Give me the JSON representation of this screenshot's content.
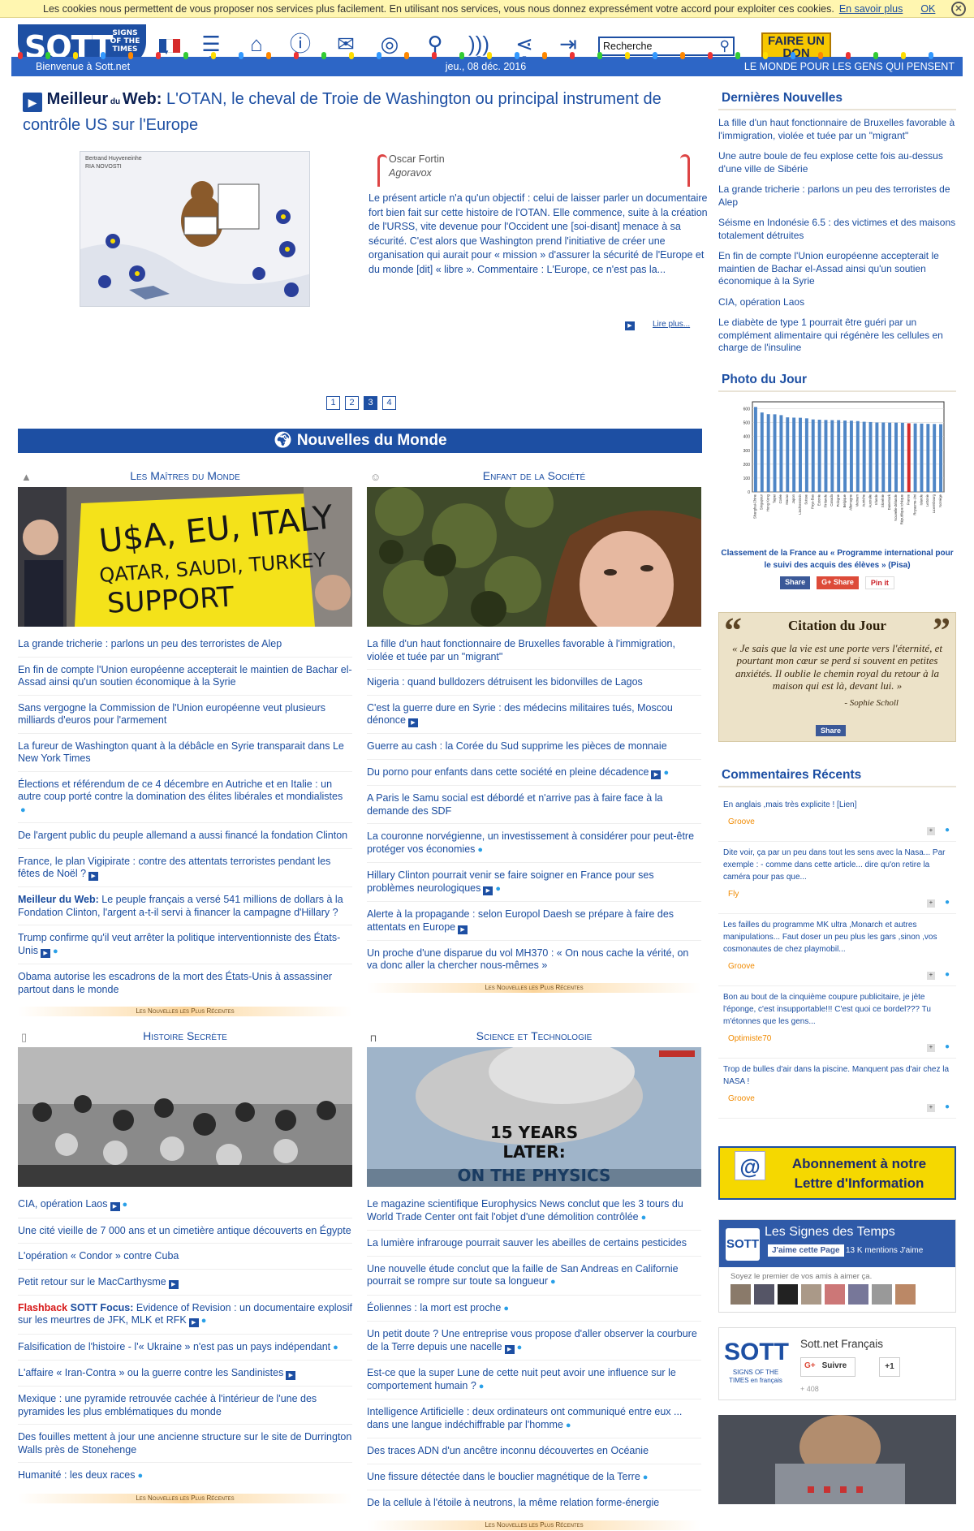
{
  "cookie": {
    "text": "Les cookies nous permettent de vous proposer nos services plus facilement. En utilisant nos services, vous nous donnez expressément votre accord pour exploiter ces cookies.",
    "link": "En savoir plus",
    "ok": "OK"
  },
  "header": {
    "logo_big": "SOTT",
    "logo_small": "SIGNS OF THE TIMES",
    "search_value": "Recherche",
    "donate": "FAIRE UN DON",
    "welcome": "Bienvenue à Sott.net",
    "date": "jeu., 08 déc. 2016",
    "slogan": "LE MONDE POUR LES GENS QUI PENSENT"
  },
  "feature": {
    "prefix_a": "Meilleur",
    "prefix_b": "du",
    "prefix_c": "Web:",
    "title": "L'OTAN, le cheval de Troie de Washington ou principal instrument de contrôle US sur l'Europe",
    "author": "Oscar Fortin",
    "source": "Agoravox",
    "text": "Le présent article n'a qu'un objectif : celui de laisser parler un documentaire fort bien fait sur cette histoire de l'OTAN. Elle commence, suite à la création de l'URSS, vite devenue pour l'Occident une [soi-disant] menace à sa sécurité. C'est alors que Washington prend l'initiative de créer une organisation qui aurait pour « mission » d'assurer la sécurité de l'Europe et du monde [dit] « libre ». Commentaire : L'Europe, ce n'est pas la...",
    "read_more": "Lire plus...",
    "img_caption_1": "Bertrand Huyveneinhe",
    "img_caption_2": "RIA NOVOSTI"
  },
  "pager": [
    "1",
    "2",
    "3",
    "4"
  ],
  "world_news_title": "Nouvelles du Monde",
  "more_label": "Les Nouvelles les Plus Récentes",
  "sections": {
    "maitres": {
      "title": "Les Maîtres du Monde",
      "sign_text": "U$A, EU, ITALY QATAR, SAUDI, TURKEY SUPPORT TERRORISTS",
      "items": [
        "La grande tricherie : parlons un peu des terroristes de Alep",
        "En fin de compte l'Union européenne accepterait le maintien de Bachar el-Assad ainsi qu'un soutien économique à la Syrie",
        "Sans vergogne la Commission de l'Union européenne veut plusieurs milliards d'euros pour l'armement",
        "La fureur de Washington quant à la débâcle en Syrie transparait dans Le New York Times",
        "Élections et référendum de ce 4 décembre en Autriche et en Italie : un autre coup porté contre la domination des élites libérales et mondialistes",
        "De l'argent public du peuple allemand a aussi financé la fondation Clinton",
        "France, le plan Vigipirate : contre des attentats terroristes pendant les fêtes de Noël ?",
        "Le peuple français a versé 541 millions de dollars à la Fondation Clinton, l'argent a-t-il servi à financer la campagne d'Hillary ?",
        "Trump confirme qu'il veut arrêter la politique interventionniste des États-Unis",
        "Obama autorise les escadrons de la mort des États-Unis à assassiner partout dans le monde"
      ],
      "bold_prefix": "Meilleur du Web:"
    },
    "societe": {
      "title": "Enfant de la Société",
      "items": [
        "La fille d'un haut fonctionnaire de Bruxelles favorable à l'immigration, violée et tuée par un \"migrant\"",
        "Nigeria : quand bulldozers détruisent les bidonvilles de Lagos",
        "C'est la guerre dure en Syrie : des médecins militaires tués, Moscou dénonce",
        "Guerre au cash : la Corée du Sud supprime les pièces de monnaie",
        "Du porno pour enfants dans cette société en pleine décadence",
        "A Paris le Samu social est débordé et n'arrive pas à faire face à la demande des SDF",
        "La couronne norvégienne, un investissement à considérer pour peut-être protéger vos économies",
        "Hillary Clinton pourrait venir se faire soigner en France pour ses problèmes neurologiques",
        "Alerte à la propagande : selon Europol Daesh se prépare à faire des attentats en Europe",
        "Un proche d'une disparue du vol MH370 : « On nous cache la vérité, on va donc aller la chercher nous-mêmes »"
      ]
    },
    "histoire": {
      "title": "Histoire Secrète",
      "items": [
        "CIA, opération Laos",
        "Une cité vieille de 7 000 ans et un cimetière antique découverts en Égypte",
        "L'opération « Condor » contre Cuba",
        "Petit retour sur le MacCarthysme",
        "Evidence of Revision : un documentaire explosif sur les meurtres de JFK, MLK et RFK",
        "Falsification de l'histoire - l'« Ukraine » n'est pas un pays indépendant",
        "L'affaire « Iran-Contra » ou la guerre contre les Sandinistes",
        "Mexique : une pyramide retrouvée cachée à l'intérieur de l'une des pyramides les plus emblématiques du monde",
        "Des fouilles mettent à jour une ancienne structure sur le site de Durrington Walls près de Stonehenge",
        "Humanité : les deux races"
      ],
      "flashback": "Flashback",
      "sott_focus": "SOTT Focus:"
    },
    "science": {
      "title": "Science et Technologie",
      "img_line1": "15 YEARS",
      "img_line2": "LATER:",
      "img_line3": "ON THE PHYSICS",
      "items": [
        "Le magazine scientifique Europhysics News conclut que les 3 tours du World Trade Center ont fait l'objet d'une démolition contrôlée",
        "La lumière infrarouge pourrait sauver les abeilles de certains pesticides",
        "Une nouvelle étude conclut que la faille de San Andreas en Californie pourrait se rompre sur toute sa longueur",
        "Éoliennes : la mort est proche",
        "Un petit doute ? Une entreprise vous propose d'aller observer la courbure de la Terre depuis une nacelle",
        "Est-ce que la super Lune de cette nuit peut avoir une influence sur le comportement humain ?",
        "Intelligence Artificielle : deux ordinateurs ont communiqué entre eux ... dans une langue indéchiffrable par l'homme",
        "Des traces ADN d'un ancêtre inconnu découvertes en Océanie",
        "Une fissure détectée dans le bouclier magnétique de la Terre",
        "De la cellule à l'étoile à neutrons, la même relation forme-énergie"
      ]
    }
  },
  "sidebar": {
    "latest_title": "Dernières Nouvelles",
    "latest": [
      "La fille d'un haut fonctionnaire de Bruxelles favorable à l'immigration, violée et tuée par un \"migrant\"",
      "Une autre boule de feu explose cette fois au-dessus d'une ville de Sibérie",
      "La grande tricherie : parlons un peu des terroristes de Alep",
      "Séisme en Indonésie 6.5 : des victimes et des maisons totalement détruites",
      "En fin de compte l'Union européenne accepterait le maintien de Bachar el-Assad ainsi qu'un soutien économique à la Syrie",
      "CIA, opération Laos",
      "Le diabète de type 1 pourrait être guéri par un complément alimentaire qui régénère les cellules en charge de l'insuline"
    ],
    "photo_title": "Photo du Jour",
    "photo_caption": "Classement de la France au « Programme international pour le suivi des acquis des élèves » (Pisa)",
    "share_fb": "Share",
    "share_gp": "G+ Share",
    "share_pin": "Pin it",
    "citation_title": "Citation du Jour",
    "citation_text": "« Je sais que la vie est une porte vers l'éternité, et pourtant mon cœur se perd si souvent en petites anxiétés. Il oublie le chemin royal du retour à la maison qui est là, devant lui. »",
    "citation_author": "- Sophie Scholl",
    "citation_share": "Share",
    "comments_title": "Commentaires Récents",
    "comments": [
      {
        "text": "En anglais ,mais très explicite ! [Lien]",
        "by": "Groove"
      },
      {
        "text": "Dite voir, ça par un peu dans tout les sens avec la Nasa... Par exemple : - comme dans cette article... dire qu'on retire la caméra pour pas que...",
        "by": "Fly"
      },
      {
        "text": "Les failles du programme MK ultra ,Monarch et autres manipulations... Faut doser un peu plus les gars ,sinon ,vos cosmonautes de chez playmobil...",
        "by": "Groove"
      },
      {
        "text": "Bon au bout de la cinquième coupure publicitaire, je jète l'éponge, c'est insupportable!!! C'est quoi ce bordel??? Tu m'étonnes que les gens...",
        "by": "Optimiste70"
      },
      {
        "text": "Trop de bulles d'air dans la piscine. Manquent pas d'air chez la NASA !",
        "by": "Groove"
      }
    ],
    "newsletter": "Abonnement à notre Lettre d'Information",
    "fb_title": "Les Signes des Temps",
    "fb_like": "J'aime cette Page",
    "fb_count": "13 K mentions J'aime",
    "fb_first": "Soyez le premier de vos amis à aimer ça.",
    "gp_name": "Sott.net Français",
    "gp_follow": "Suivre",
    "gp_plus": "+1",
    "gp_count": "+ 408",
    "gp_logo_sub": "SIGNS OF THE TIMES en français"
  },
  "chart_data": {
    "type": "bar",
    "categories": [
      "Shanghai-Chine",
      "Singapour",
      "Hong Kong",
      "Taipei",
      "Corée",
      "Macao",
      "Japon",
      "Liechtenstein",
      "Suisse",
      "Pays-Bas",
      "Estonie",
      "Finlande",
      "Canada",
      "Pologne",
      "Belgique",
      "Allemagne",
      "Vietnam",
      "Autriche",
      "Australie",
      "Irlande",
      "Slovénie",
      "Danemark",
      "Nouvelle-Zélande",
      "République tchèque",
      "France",
      "Royaume-Uni",
      "Islande",
      "Lettonie",
      "Luxembourg",
      "Norvège"
    ],
    "values": [
      613,
      573,
      561,
      560,
      554,
      538,
      536,
      535,
      531,
      523,
      521,
      519,
      518,
      518,
      515,
      514,
      511,
      506,
      504,
      501,
      501,
      500,
      500,
      499,
      495,
      494,
      493,
      491,
      490,
      489
    ],
    "highlight": "France",
    "ylim": [
      0,
      650
    ],
    "colors": {
      "bar": "#4f86c6",
      "highlight": "#d62b2b"
    }
  }
}
